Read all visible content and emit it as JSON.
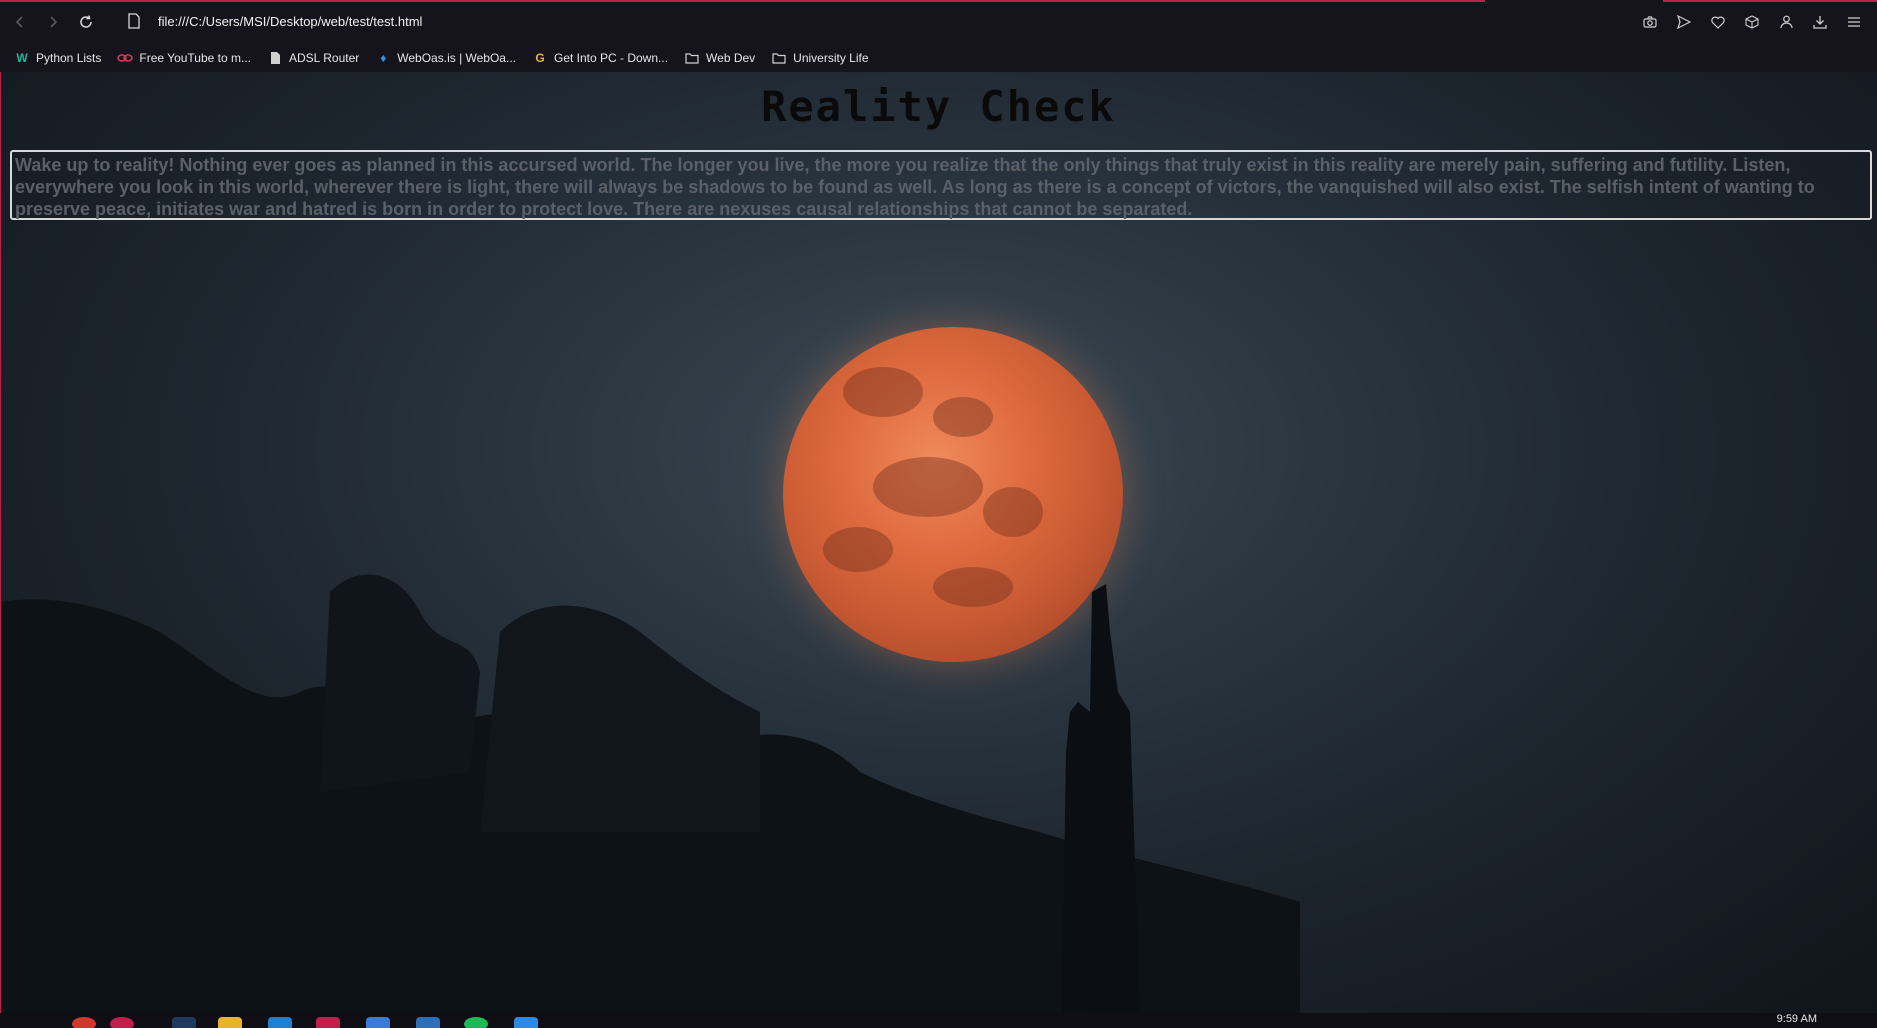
{
  "browser": {
    "url": "file:///C:/Users/MSI/Desktop/web/test/test.html",
    "bookmarks": [
      {
        "label": "Python Lists",
        "icon": "w-logo-icon",
        "color": "#1fb89e"
      },
      {
        "label": "Free YouTube to m...",
        "icon": "link-icon",
        "color": "#e0335a"
      },
      {
        "label": "ADSL Router",
        "icon": "page-icon",
        "color": "#d0d0d0"
      },
      {
        "label": "WebOas.is | WebOa...",
        "icon": "webo-icon",
        "color": "#3a8ee6"
      },
      {
        "label": "Get Into PC - Down...",
        "icon": "g-logo-icon",
        "color": "#e8b32a"
      },
      {
        "label": "Web Dev",
        "icon": "folder-icon",
        "color": "#d0d0d0"
      },
      {
        "label": "University Life",
        "icon": "folder-icon",
        "color": "#d0d0d0"
      }
    ]
  },
  "page": {
    "title": "Reality Check",
    "quote": "Wake up to reality! Nothing ever goes as planned in this accursed world. The longer you live, the more you realize that the only things that truly exist in this reality are merely pain, suffering and futility. Listen, everywhere you look in this world, wherever there is light, there will always be shadows to be found as well. As long as there is a concept of victors, the vanquished will also exist. The selfish intent of wanting to preserve peace, initiates war and hatred is born in order to protect love. There are nexuses causal relationships that cannot be separated."
  },
  "taskbar": {
    "clock": "9:59 AM"
  },
  "colors": {
    "accent": "#c21e4a",
    "chrome": "#15141c",
    "moon": "#de6a3e"
  }
}
